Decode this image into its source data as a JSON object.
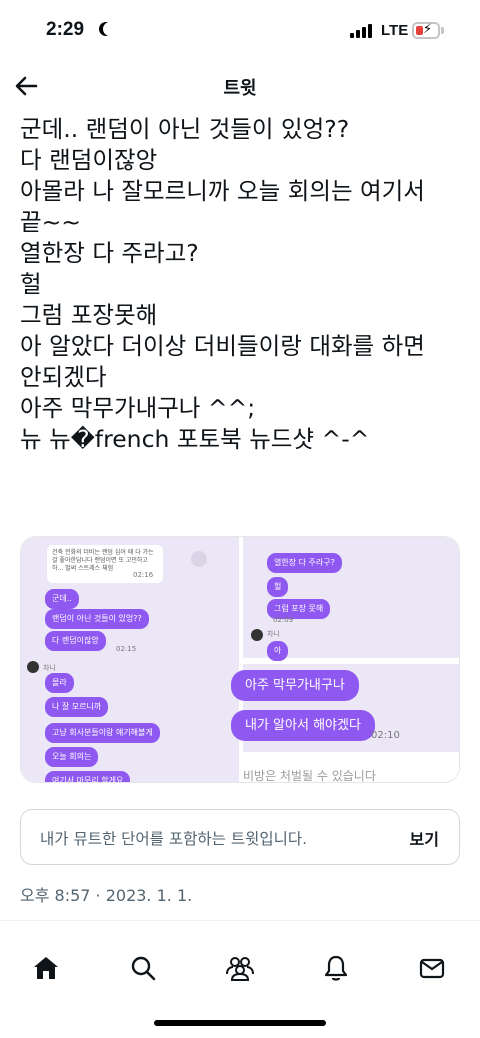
{
  "status_bar": {
    "time": "2:29",
    "network": "LTE"
  },
  "header": {
    "title": "트윗",
    "back_icon": "arrow-left-icon"
  },
  "tweet": {
    "lines": [
      "군데.. 랜덤이 아닌 것들이 있엉??",
      "다 랜덤이잖앙",
      "아몰라 나 잘모르니까 오늘 회의는 여기서",
      "끝~~",
      "열한장 다 주라고?",
      "헐",
      "그럼 포장못해",
      "아 알았다 더이상 더비들이랑 대화를 하면",
      "안되겠다",
      "아주 막무가내구나 ^^;",
      "뉴 뉴�french 포토북 뉴드샷 ^-^"
    ]
  },
  "media": {
    "left_panel": {
      "notice": "건축 전화의 더비는 랜덤 심어 때 다 가는걸 좋아한답니다 랜덤이면 또 고민하고 하... 벌써 스트레스 체험",
      "bubbles": [
        "군데..",
        "랜덤이 아닌 것들이 있엉??",
        "다 랜덤이잖앙",
        "몰라",
        "나 잘 모르니까",
        "고냥 회사분들이랑 얘기해볼게",
        "오늘 회의는",
        "여기서 마무리 할게요"
      ],
      "name": "차니",
      "times": [
        "02:16",
        "02:15"
      ]
    },
    "right_panel": {
      "bubbles": [
        "열한장 다 주라구?",
        "헐",
        "그럼 포장 못해",
        "아"
      ],
      "name": "차니",
      "time_top": "02:09",
      "big_bubbles": [
        "아주 막무가내구나",
        "내가 알아서 해야겠다"
      ],
      "time_bottom": "02:10",
      "caption": "비방은 처벌될 수 있습니다"
    }
  },
  "muted": {
    "text": "내가 뮤트한 단어를 포함하는 트윗입니다.",
    "action": "보기"
  },
  "timestamp": "오후 8:57 · 2023. 1. 1.",
  "nav": [
    "home-icon",
    "search-icon",
    "communities-icon",
    "notifications-icon",
    "messages-icon"
  ],
  "colors": {
    "bubble": "#8f59f1",
    "chat_bg": "#ece7f7",
    "muted_text": "#536471"
  }
}
